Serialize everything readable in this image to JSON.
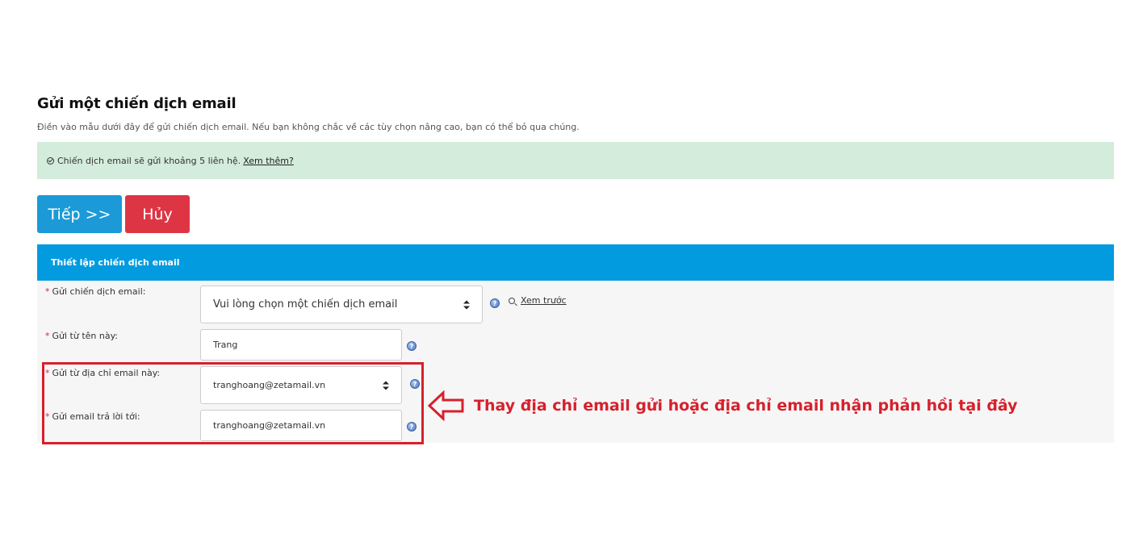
{
  "header": {
    "title": "Gửi một chiến dịch email",
    "subtitle": "Điền vào mẫu dưới đây để gửi chiến dịch email. Nếu bạn không chắc về các tùy chọn nâng cao, bạn có thể bỏ qua chúng."
  },
  "alert": {
    "text": "Chiến dịch email sẽ gửi khoảng 5 liên hệ.",
    "link_label": "Xem thêm?",
    "icon": "check-circle-icon"
  },
  "buttons": {
    "next_label": "Tiếp >>",
    "cancel_label": "Hủy"
  },
  "panel": {
    "title": "Thiết lập chiến dịch email"
  },
  "form": {
    "required_mark": "*",
    "campaign": {
      "label": "Gửi chiến dịch email:",
      "selected": "Vui lòng chọn một chiến dịch email",
      "preview_label": "Xem trước"
    },
    "from_name": {
      "label": "Gửi từ tên này:",
      "value": "Trang"
    },
    "from_email": {
      "label": "Gửi từ địa chỉ email này:",
      "selected": "tranghoang@zetamail.vn"
    },
    "reply_to": {
      "label": "Gửi email trả lời tới:",
      "value": "tranghoang@zetamail.vn"
    }
  },
  "annotation": {
    "text": "Thay địa chỉ email gửi hoặc địa chỉ email nhận phản hồi tại đây",
    "color": "#d7202c"
  },
  "colors": {
    "primary": "#1b9ad7",
    "danger": "#de3545",
    "panel_header": "#039bdf",
    "alert_bg": "#d4ecdb"
  }
}
